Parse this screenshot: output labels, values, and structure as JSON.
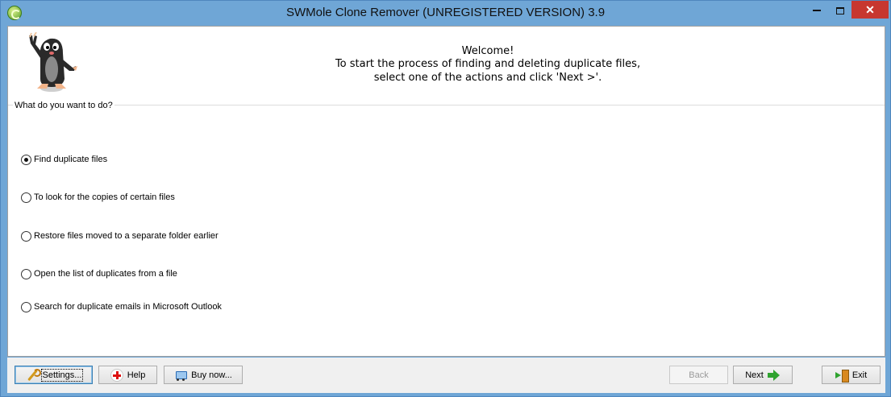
{
  "window": {
    "title": "SWMole Clone Remover (UNREGISTERED VERSION) 3.9",
    "minimize_label": "",
    "maximize_label": "",
    "close_label": "✕"
  },
  "header": {
    "welcome_line1": "Welcome!",
    "welcome_line2": "To start the process of finding and deleting duplicate files,",
    "welcome_line3": "select one of the actions and click 'Next >'."
  },
  "group": {
    "label": "What do you want to do?",
    "options": [
      {
        "label": "Find duplicate files",
        "selected": true
      },
      {
        "label": "To look for the copies of certain files",
        "selected": false
      },
      {
        "label": "Restore files moved to a separate folder earlier",
        "selected": false
      },
      {
        "label": "Open the list of duplicates from a file",
        "selected": false
      },
      {
        "label": "Search for duplicate emails in Microsoft Outlook",
        "selected": false
      }
    ]
  },
  "footer": {
    "settings_label": "Settings...",
    "help_label": "Help",
    "buy_label": "Buy now...",
    "back_label": "Back",
    "next_label": "Next",
    "exit_label": "Exit"
  },
  "colors": {
    "title_bar": "#6fa6d6",
    "close_button": "#c7372f",
    "client_background": "#ffffff",
    "footer_background": "#f0f0f0"
  }
}
